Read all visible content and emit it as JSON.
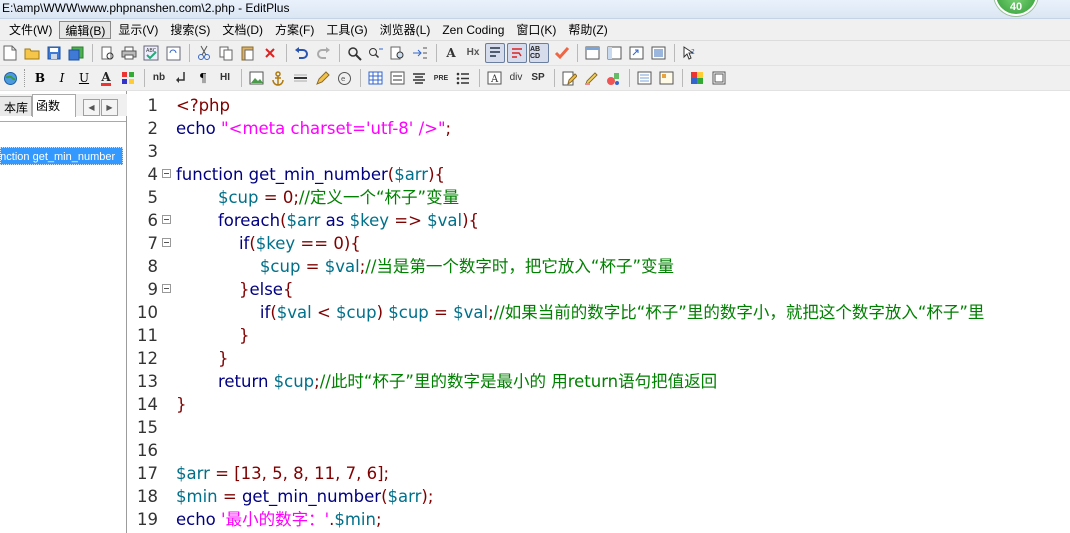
{
  "window": {
    "title": "E:\\amp\\WWW\\www.phpnanshen.com\\2.php - EditPlus",
    "badge": "40"
  },
  "menu": [
    "文件(W)",
    "编辑(B)",
    "显示(V)",
    "搜索(S)",
    "文档(D)",
    "方案(F)",
    "工具(G)",
    "浏览器(L)",
    "Zen Coding",
    "窗口(K)",
    "帮助(Z)"
  ],
  "active_menu_index": 1,
  "toolbar2_labels": {
    "bold": "B",
    "italic": "I",
    "underline": "U",
    "font_color": "A",
    "nb": "nb",
    "para": "¶",
    "hr": "HI",
    "pre": "PRE",
    "div": "div",
    "sp": "SP",
    "aa": "A",
    "hx": "Hx",
    "abcd": "AB CD"
  },
  "left_panel": {
    "tabs": [
      "本库",
      "函数"
    ],
    "items": [
      "function get_min_number"
    ]
  },
  "editor": {
    "lines": [
      {
        "num": "1",
        "fold": false,
        "tokens": [
          {
            "t": "<?php",
            "c": "n"
          }
        ]
      },
      {
        "num": "2",
        "fold": false,
        "tokens": [
          {
            "t": "echo ",
            "c": "k"
          },
          {
            "t": "\"<meta charset='utf-8' />\"",
            "c": "s"
          },
          {
            "t": ";",
            "c": "p"
          }
        ]
      },
      {
        "num": "3",
        "fold": false,
        "tokens": []
      },
      {
        "num": "4",
        "fold": true,
        "tokens": [
          {
            "t": "function ",
            "c": "k"
          },
          {
            "t": "get_min_number",
            "c": "k"
          },
          {
            "t": "(",
            "c": "p"
          },
          {
            "t": "$arr",
            "c": "v"
          },
          {
            "t": "){",
            "c": "p"
          }
        ]
      },
      {
        "num": "5",
        "fold": false,
        "tokens": [
          {
            "t": "        ",
            "c": "k"
          },
          {
            "t": "$cup",
            "c": "v"
          },
          {
            "t": " = ",
            "c": "p"
          },
          {
            "t": "0",
            "c": "n"
          },
          {
            "t": ";",
            "c": "p"
          },
          {
            "t": "//定义一个“杯子”变量",
            "c": "c"
          }
        ]
      },
      {
        "num": "6",
        "fold": true,
        "tokens": [
          {
            "t": "        foreach",
            "c": "k"
          },
          {
            "t": "(",
            "c": "p"
          },
          {
            "t": "$arr",
            "c": "v"
          },
          {
            "t": " as ",
            "c": "k"
          },
          {
            "t": "$key",
            "c": "v"
          },
          {
            "t": " => ",
            "c": "p"
          },
          {
            "t": "$val",
            "c": "v"
          },
          {
            "t": "){",
            "c": "p"
          }
        ]
      },
      {
        "num": "7",
        "fold": true,
        "tokens": [
          {
            "t": "            if",
            "c": "k"
          },
          {
            "t": "(",
            "c": "p"
          },
          {
            "t": "$key",
            "c": "v"
          },
          {
            "t": " == ",
            "c": "p"
          },
          {
            "t": "0",
            "c": "n"
          },
          {
            "t": "){",
            "c": "p"
          }
        ]
      },
      {
        "num": "8",
        "fold": false,
        "tokens": [
          {
            "t": "                ",
            "c": "k"
          },
          {
            "t": "$cup",
            "c": "v"
          },
          {
            "t": " = ",
            "c": "p"
          },
          {
            "t": "$val",
            "c": "v"
          },
          {
            "t": ";",
            "c": "p"
          },
          {
            "t": "//当是第一个数字时，把它放入“杯子”变量",
            "c": "c"
          }
        ]
      },
      {
        "num": "9",
        "fold": true,
        "tokens": [
          {
            "t": "            ",
            "c": "k"
          },
          {
            "t": "}",
            "c": "p"
          },
          {
            "t": "else",
            "c": "k"
          },
          {
            "t": "{",
            "c": "p"
          }
        ]
      },
      {
        "num": "10",
        "fold": false,
        "tokens": [
          {
            "t": "                if",
            "c": "k"
          },
          {
            "t": "(",
            "c": "p"
          },
          {
            "t": "$val",
            "c": "v"
          },
          {
            "t": " < ",
            "c": "p"
          },
          {
            "t": "$cup",
            "c": "v"
          },
          {
            "t": ") ",
            "c": "p"
          },
          {
            "t": "$cup",
            "c": "v"
          },
          {
            "t": " = ",
            "c": "p"
          },
          {
            "t": "$val",
            "c": "v"
          },
          {
            "t": ";",
            "c": "p"
          },
          {
            "t": "//如果当前的数字比“杯子”里的数字小，就把这个数字放入“杯子”里",
            "c": "c"
          }
        ]
      },
      {
        "num": "11",
        "fold": false,
        "tokens": [
          {
            "t": "            }",
            "c": "p"
          }
        ]
      },
      {
        "num": "12",
        "fold": false,
        "tokens": [
          {
            "t": "        }",
            "c": "p"
          }
        ]
      },
      {
        "num": "13",
        "fold": false,
        "tokens": [
          {
            "t": "        return ",
            "c": "k"
          },
          {
            "t": "$cup",
            "c": "v"
          },
          {
            "t": ";",
            "c": "p"
          },
          {
            "t": "//此时“杯子”里的数字是最小的 用return语句把值返回",
            "c": "c"
          }
        ]
      },
      {
        "num": "14",
        "fold": false,
        "tokens": [
          {
            "t": "}",
            "c": "p"
          }
        ]
      },
      {
        "num": "15",
        "fold": false,
        "tokens": []
      },
      {
        "num": "16",
        "fold": false,
        "tokens": []
      },
      {
        "num": "17",
        "fold": false,
        "tokens": [
          {
            "t": "$arr",
            "c": "v"
          },
          {
            "t": " = [",
            "c": "p"
          },
          {
            "t": "13, 5, 8, 11, 7, 6",
            "c": "n"
          },
          {
            "t": "];",
            "c": "p"
          }
        ]
      },
      {
        "num": "18",
        "fold": false,
        "tokens": [
          {
            "t": "$min",
            "c": "v"
          },
          {
            "t": " = ",
            "c": "p"
          },
          {
            "t": "get_min_number",
            "c": "k"
          },
          {
            "t": "(",
            "c": "p"
          },
          {
            "t": "$arr",
            "c": "v"
          },
          {
            "t": ");",
            "c": "p"
          }
        ]
      },
      {
        "num": "19",
        "fold": false,
        "tokens": [
          {
            "t": "echo ",
            "c": "k"
          },
          {
            "t": "'最小的数字：'",
            "c": "s"
          },
          {
            "t": ".",
            "c": "p"
          },
          {
            "t": "$min",
            "c": "v"
          },
          {
            "t": ";",
            "c": "p"
          }
        ]
      }
    ]
  },
  "colors": {
    "keyword": "#000080",
    "variable": "#00708a",
    "string": "#ff00ff",
    "comment": "#008000",
    "number": "#800000",
    "selection": "#3399ff"
  }
}
